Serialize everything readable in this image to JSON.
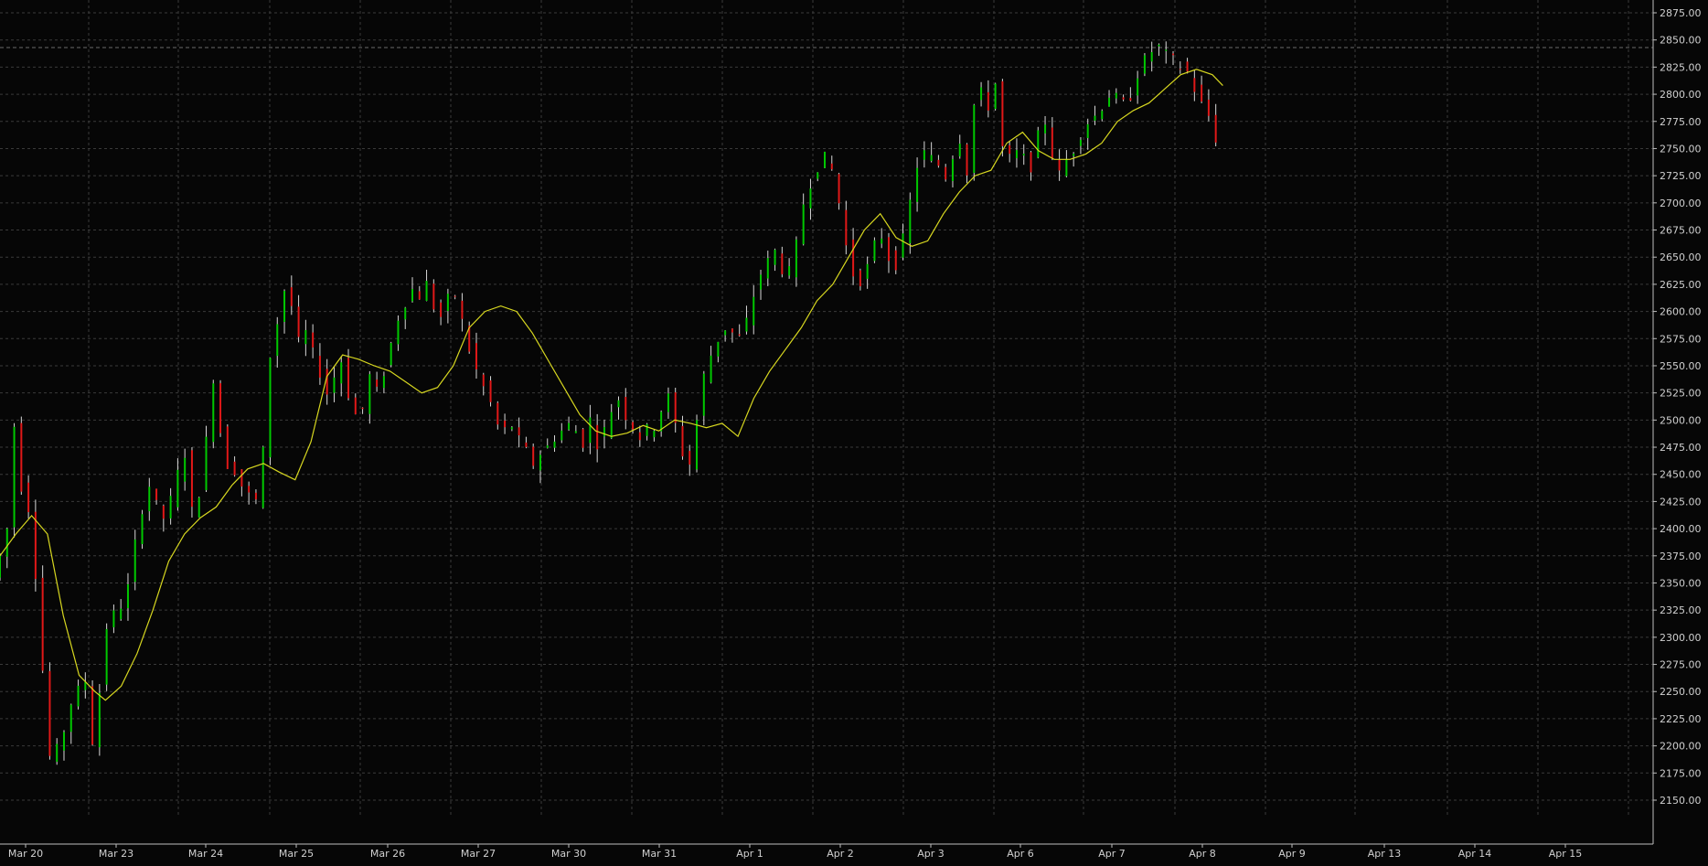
{
  "chart_data": {
    "type": "line",
    "title": "",
    "xlabel": "",
    "ylabel": "",
    "grid": true,
    "legend": "none",
    "ylim": [
      2150,
      2875
    ],
    "y_ticks": [
      "2150.00",
      "2175.00",
      "2200.00",
      "2225.00",
      "2250.00",
      "2275.00",
      "2300.00",
      "2325.00",
      "2350.00",
      "2375.00",
      "2400.00",
      "2425.00",
      "2450.00",
      "2475.00",
      "2500.00",
      "2525.00",
      "2550.00",
      "2575.00",
      "2600.00",
      "2625.00",
      "2650.00",
      "2675.00",
      "2700.00",
      "2725.00",
      "2750.00",
      "2775.00",
      "2800.00",
      "2825.00",
      "2850.00",
      "2875.00"
    ],
    "x_ticks": [
      "Mar 20",
      "Mar 23",
      "Mar 24",
      "Mar 25",
      "Mar 26",
      "Mar 27",
      "Mar 30",
      "Mar 31",
      "Apr 1",
      "Apr 2",
      "Apr 3",
      "Apr 6",
      "Apr 7",
      "Apr 8",
      "Apr 9",
      "Apr 13",
      "Apr 14",
      "Apr 15"
    ],
    "reference_line": 2843,
    "colors": {
      "up": "#00c800",
      "down": "#e01818",
      "neutral": "#d8d8d8",
      "ma": "#d8d820",
      "grid": "#3a3a3a",
      "background": "#060606"
    },
    "series": [
      {
        "kind": "price",
        "x": [
          0,
          1,
          2,
          3,
          4,
          5,
          6,
          7,
          8,
          9,
          10,
          11,
          12,
          13,
          14,
          15,
          16,
          17,
          18
        ],
        "values": [
          2355,
          2375,
          2400,
          2495,
          2440,
          2420,
          2360,
          2270,
          2190,
          2195,
          2215,
          2240,
          2250,
          2260,
          2205,
          2250,
          2310,
          2320,
          2330
        ]
      },
      {
        "kind": "moving_average",
        "x": [
          0,
          1,
          2,
          3,
          4,
          5,
          6,
          7,
          8,
          9,
          10,
          11,
          12,
          13,
          14,
          15,
          16,
          17,
          18
        ],
        "values": [
          2375,
          2380,
          2395,
          2410,
          2412,
          2400,
          2360,
          2310,
          2270,
          2252,
          2250,
          2248,
          2244,
          2245,
          2246,
          2252,
          2265,
          2280,
          2295
        ]
      }
    ],
    "price_path": [
      [
        0,
        2355
      ],
      [
        1,
        2375
      ],
      [
        2,
        2400
      ],
      [
        3,
        2495
      ],
      [
        4,
        2440
      ],
      [
        5,
        2420
      ],
      [
        6,
        2360
      ],
      [
        7,
        2270
      ],
      [
        8,
        2190
      ],
      [
        9,
        2195
      ],
      [
        10,
        2215
      ],
      [
        11,
        2240
      ],
      [
        12,
        2250
      ],
      [
        13,
        2260
      ],
      [
        14,
        2205
      ],
      [
        15,
        2250
      ],
      [
        16,
        2310
      ],
      [
        17,
        2320
      ],
      [
        18,
        2330
      ],
      [
        19,
        2345
      ],
      [
        20,
        2385
      ],
      [
        21,
        2420
      ],
      [
        22,
        2440
      ],
      [
        23,
        2420
      ],
      [
        24,
        2410
      ],
      [
        25,
        2425
      ],
      [
        26,
        2450
      ],
      [
        27,
        2470
      ],
      [
        28,
        2415
      ],
      [
        29,
        2435
      ],
      [
        30,
        2480
      ],
      [
        31,
        2540
      ],
      [
        32,
        2490
      ],
      [
        33,
        2460
      ],
      [
        34,
        2455
      ],
      [
        35,
        2440
      ],
      [
        36,
        2430
      ],
      [
        37,
        2425
      ],
      [
        38,
        2470
      ],
      [
        39,
        2560
      ],
      [
        40,
        2590
      ],
      [
        41,
        2620
      ],
      [
        42,
        2605
      ],
      [
        43,
        2570
      ],
      [
        44,
        2580
      ],
      [
        45,
        2560
      ],
      [
        46,
        2545
      ],
      [
        47,
        2525
      ],
      [
        48,
        2540
      ],
      [
        49,
        2555
      ],
      [
        50,
        2525
      ],
      [
        51,
        2505
      ],
      [
        52,
        2510
      ],
      [
        53,
        2540
      ],
      [
        54,
        2525
      ],
      [
        55,
        2545
      ],
      [
        56,
        2570
      ],
      [
        57,
        2595
      ],
      [
        58,
        2610
      ],
      [
        59,
        2620
      ],
      [
        60,
        2615
      ],
      [
        61,
        2625
      ],
      [
        62,
        2605
      ],
      [
        63,
        2595
      ],
      [
        64,
        2610
      ],
      [
        65,
        2615
      ],
      [
        66,
        2590
      ],
      [
        67,
        2565
      ],
      [
        68,
        2545
      ],
      [
        69,
        2530
      ],
      [
        70,
        2515
      ],
      [
        71,
        2495
      ],
      [
        72,
        2490
      ],
      [
        73,
        2495
      ],
      [
        74,
        2480
      ],
      [
        75,
        2470
      ],
      [
        76,
        2460
      ],
      [
        77,
        2470
      ],
      [
        78,
        2475
      ],
      [
        79,
        2485
      ],
      [
        80,
        2490
      ],
      [
        81,
        2495
      ],
      [
        82,
        2490
      ],
      [
        83,
        2480
      ],
      [
        84,
        2500
      ],
      [
        85,
        2480
      ],
      [
        86,
        2490
      ],
      [
        87,
        2510
      ],
      [
        88,
        2520
      ],
      [
        89,
        2505
      ],
      [
        90,
        2495
      ],
      [
        91,
        2485
      ],
      [
        92,
        2490
      ],
      [
        93,
        2495
      ],
      [
        94,
        2510
      ],
      [
        95,
        2520
      ],
      [
        96,
        2495
      ],
      [
        97,
        2470
      ],
      [
        98,
        2460
      ],
      [
        99,
        2500
      ],
      [
        100,
        2540
      ],
      [
        101,
        2560
      ],
      [
        102,
        2575
      ],
      [
        103,
        2585
      ],
      [
        104,
        2580
      ],
      [
        105,
        2575
      ],
      [
        106,
        2590
      ],
      [
        107,
        2615
      ],
      [
        108,
        2635
      ],
      [
        109,
        2645
      ],
      [
        110,
        2655
      ],
      [
        111,
        2640
      ],
      [
        112,
        2635
      ],
      [
        113,
        2660
      ],
      [
        114,
        2700
      ],
      [
        115,
        2720
      ],
      [
        116,
        2735
      ],
      [
        117,
        2740
      ],
      [
        118,
        2730
      ],
      [
        119,
        2700
      ],
      [
        120,
        2660
      ],
      [
        121,
        2635
      ],
      [
        122,
        2630
      ],
      [
        123,
        2640
      ],
      [
        124,
        2660
      ],
      [
        125,
        2670
      ],
      [
        126,
        2650
      ],
      [
        127,
        2645
      ],
      [
        128,
        2665
      ],
      [
        129,
        2700
      ],
      [
        130,
        2735
      ],
      [
        131,
        2745
      ],
      [
        132,
        2740
      ],
      [
        133,
        2735
      ],
      [
        134,
        2725
      ],
      [
        135,
        2745
      ],
      [
        136,
        2760
      ],
      [
        137,
        2730
      ],
      [
        138,
        2790
      ],
      [
        139,
        2800
      ],
      [
        140,
        2790
      ],
      [
        141,
        2810
      ],
      [
        142,
        2750
      ],
      [
        143,
        2740
      ],
      [
        144,
        2745
      ],
      [
        145,
        2740
      ],
      [
        146,
        2735
      ],
      [
        147,
        2760
      ],
      [
        148,
        2775
      ],
      [
        149,
        2745
      ],
      [
        150,
        2725
      ],
      [
        151,
        2740
      ],
      [
        152,
        2750
      ],
      [
        153,
        2765
      ],
      [
        154,
        2775
      ],
      [
        155,
        2780
      ],
      [
        156,
        2790
      ],
      [
        157,
        2800
      ],
      [
        158,
        2795
      ],
      [
        159,
        2790
      ],
      [
        160,
        2800
      ],
      [
        161,
        2820
      ],
      [
        162,
        2830
      ],
      [
        163,
        2840
      ],
      [
        164,
        2843
      ],
      [
        165,
        2835
      ],
      [
        166,
        2830
      ],
      [
        167,
        2825
      ],
      [
        168,
        2820
      ],
      [
        169,
        2805
      ],
      [
        170,
        2790
      ],
      [
        171,
        2780
      ],
      [
        172,
        2760
      ]
    ],
    "ma_path": [
      [
        0,
        2375
      ],
      [
        3,
        2395
      ],
      [
        6,
        2412
      ],
      [
        9,
        2395
      ],
      [
        12,
        2320
      ],
      [
        15,
        2265
      ],
      [
        18,
        2250
      ],
      [
        20,
        2242
      ],
      [
        23,
        2255
      ],
      [
        26,
        2285
      ],
      [
        29,
        2325
      ],
      [
        32,
        2370
      ],
      [
        35,
        2395
      ],
      [
        38,
        2410
      ],
      [
        41,
        2420
      ],
      [
        44,
        2440
      ],
      [
        47,
        2455
      ],
      [
        50,
        2460
      ],
      [
        53,
        2452
      ],
      [
        56,
        2445
      ],
      [
        59,
        2480
      ],
      [
        62,
        2540
      ],
      [
        65,
        2560
      ],
      [
        68,
        2556
      ],
      [
        71,
        2550
      ],
      [
        74,
        2545
      ],
      [
        77,
        2535
      ],
      [
        80,
        2525
      ],
      [
        83,
        2530
      ],
      [
        86,
        2550
      ],
      [
        89,
        2585
      ],
      [
        92,
        2600
      ],
      [
        95,
        2605
      ],
      [
        98,
        2600
      ],
      [
        101,
        2580
      ],
      [
        104,
        2555
      ],
      [
        107,
        2530
      ],
      [
        110,
        2505
      ],
      [
        113,
        2490
      ],
      [
        116,
        2485
      ],
      [
        119,
        2488
      ],
      [
        122,
        2495
      ],
      [
        125,
        2490
      ],
      [
        128,
        2500
      ],
      [
        131,
        2497
      ],
      [
        134,
        2493
      ],
      [
        137,
        2497
      ],
      [
        140,
        2485
      ],
      [
        143,
        2520
      ],
      [
        146,
        2545
      ],
      [
        149,
        2565
      ],
      [
        152,
        2585
      ],
      [
        155,
        2610
      ],
      [
        158,
        2625
      ],
      [
        161,
        2650
      ],
      [
        164,
        2675
      ],
      [
        167,
        2690
      ],
      [
        170,
        2668
      ],
      [
        173,
        2660
      ],
      [
        176,
        2665
      ],
      [
        179,
        2690
      ],
      [
        182,
        2710
      ],
      [
        185,
        2725
      ],
      [
        188,
        2730
      ],
      [
        191,
        2755
      ],
      [
        194,
        2765
      ],
      [
        197,
        2748
      ],
      [
        200,
        2740
      ],
      [
        203,
        2740
      ],
      [
        206,
        2745
      ],
      [
        209,
        2755
      ],
      [
        212,
        2775
      ],
      [
        215,
        2785
      ],
      [
        218,
        2792
      ],
      [
        221,
        2805
      ],
      [
        224,
        2818
      ],
      [
        227,
        2823
      ],
      [
        230,
        2818
      ],
      [
        232,
        2808
      ]
    ]
  }
}
